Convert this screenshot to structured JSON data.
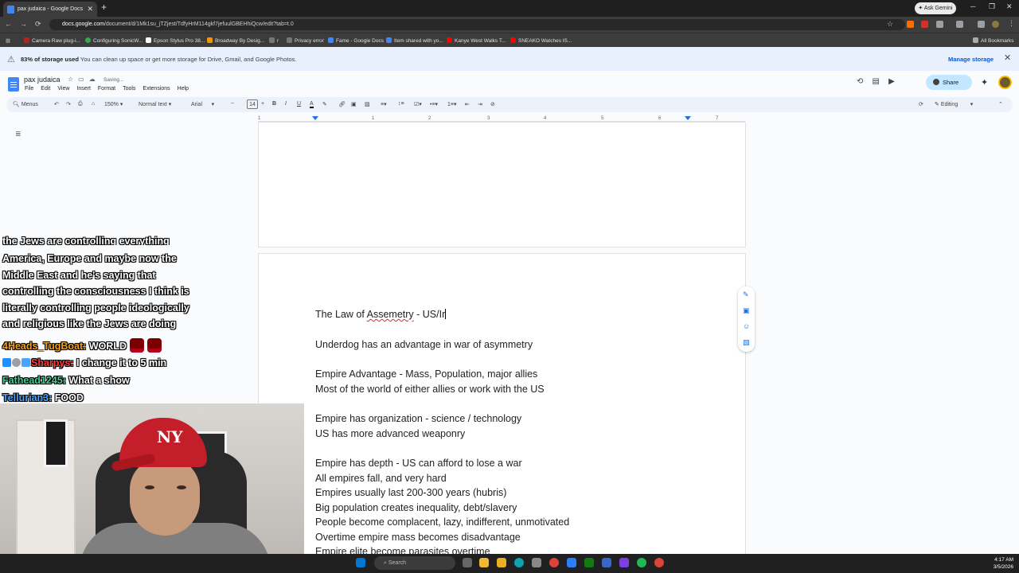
{
  "browser": {
    "tab_title": "pax judaica - Google Docs",
    "tab_close": "✕",
    "new_tab": "+",
    "ask_gemini": "Ask Gemini",
    "url_host": "docs.google.com",
    "url_path": "/document/d/1Mk1su_jTZjest/TdfyHrM114gkf7jefuulGBEHhiQcw/edit?tab=t.0",
    "bookmarks": [
      "Camera Raw plug-i...",
      "Configuring SonicW...",
      "Epson Stylus Pro 38...",
      "Broadway By Desig...",
      "r",
      "Privacy error",
      "Fame - Google Docs",
      "Item shared with yo...",
      "Kanye West Walks T...",
      "SNEAKO Watches IS..."
    ],
    "all_bookmarks": "All Bookmarks"
  },
  "storage_banner": {
    "bold": "83% of storage used",
    "text": "You can clean up space or get more storage for Drive, Gmail, and Google Photos.",
    "manage": "Manage storage",
    "close": "✕"
  },
  "docs": {
    "title": "pax judaica",
    "saving": "Saving...",
    "menus": [
      "File",
      "Edit",
      "View",
      "Insert",
      "Format",
      "Tools",
      "Extensions",
      "Help"
    ],
    "share": "Share",
    "toolbar": {
      "menus_search": "Menus",
      "zoom": "150%",
      "style": "Normal text",
      "font": "Arial",
      "font_size": "14",
      "mode": "Editing"
    },
    "ruler_ticks": [
      "1",
      "1",
      "2",
      "3",
      "4",
      "5",
      "6",
      "7"
    ]
  },
  "document": {
    "lines": [
      {
        "prefix": "The Law of ",
        "misspelled": "Assemetry",
        "suffix": " - US/Ir"
      },
      {
        "text": "Underdog has an advantage in war of asymmetry"
      },
      {
        "text": "Empire Advantage - Mass, Population, major allies"
      },
      {
        "text": "Most of the world of either allies or work with the US"
      },
      {
        "text": "Empire has organization - science / technology"
      },
      {
        "text": "US has more advanced weaponry"
      },
      {
        "text": "Empire has depth - US can afford to lose a war"
      },
      {
        "text": "All empires fall, and very hard"
      },
      {
        "text": "Empires usually last 200-300 years (hubris)"
      },
      {
        "text": "Big population creates inequality, debt/slavery"
      },
      {
        "text": "People become complacent, lazy, indifferent, unmotivated"
      },
      {
        "text": "Overtime empire mass becomes disadvantage"
      },
      {
        "text": "Empire elite become parasites overtime"
      }
    ]
  },
  "chat": {
    "lines": [
      "the Jews are controlling everything",
      "America, Europe and maybe now the",
      "Middle East and he's saying that",
      "controlling the consciousness I think is",
      "literally controlling people ideologically",
      "and religious like the Jews are doing"
    ],
    "messages": [
      {
        "user": "4Heads_TugBoat:",
        "text": "WORLD",
        "color": "#f0a020"
      },
      {
        "user": "Sharpys:",
        "text": "I change it to 5 min",
        "color": "#ff3b3b"
      },
      {
        "user": "Fathead1245:",
        "text": "What a show",
        "color": "#3ecf8e"
      },
      {
        "user": "Tellurian3:",
        "text": "FOOD",
        "color": "#4aa3ff"
      }
    ]
  },
  "taskbar": {
    "search": "Search",
    "time": "4:17 AM",
    "date": "3/5/2026"
  }
}
